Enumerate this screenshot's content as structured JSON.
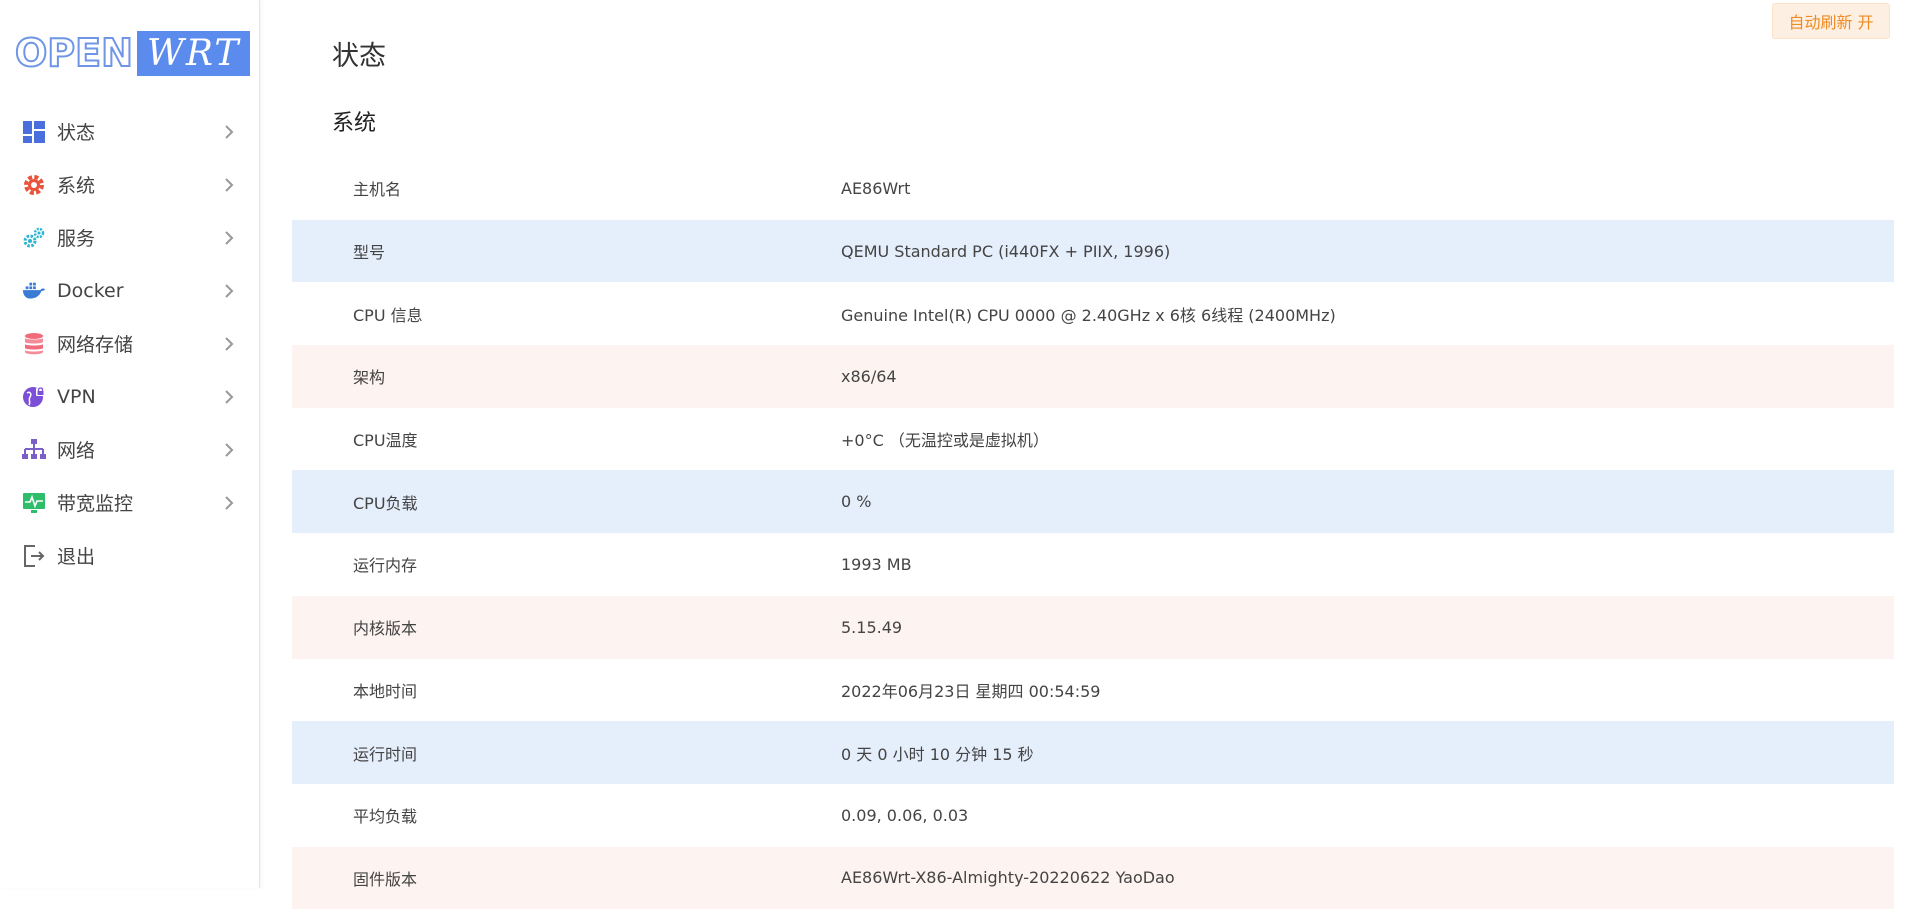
{
  "brand": {
    "logo_open": "OPEN",
    "logo_wrt": "WRT"
  },
  "sidebar": {
    "items": [
      {
        "label": "状态",
        "icon": "dashboard-icon",
        "has_chevron": true,
        "icon_color": "#4a6fdc"
      },
      {
        "label": "系统",
        "icon": "gear-icon",
        "has_chevron": true,
        "icon_color": "#e8533b"
      },
      {
        "label": "服务",
        "icon": "gears-icon",
        "has_chevron": true,
        "icon_color": "#2bb4d4"
      },
      {
        "label": "Docker",
        "icon": "docker-whale-icon",
        "has_chevron": true,
        "icon_color": "#3a7bd5"
      },
      {
        "label": "网络存储",
        "icon": "database-icon",
        "has_chevron": true,
        "icon_color": "#f06c7c"
      },
      {
        "label": "VPN",
        "icon": "globe-lock-icon",
        "has_chevron": true,
        "icon_color": "#7b4fd6"
      },
      {
        "label": "网络",
        "icon": "network-tree-icon",
        "has_chevron": true,
        "icon_color": "#7b5fc8"
      },
      {
        "label": "带宽监控",
        "icon": "monitor-pulse-icon",
        "has_chevron": true,
        "icon_color": "#2ebd6b"
      },
      {
        "label": "退出",
        "icon": "logout-icon",
        "has_chevron": false,
        "icon_color": "#666666"
      }
    ]
  },
  "header": {
    "page_title": "状态",
    "auto_refresh_label": "自动刷新 开"
  },
  "system": {
    "section_title": "系统",
    "rows": [
      {
        "key": "主机名",
        "value": "AE86Wrt"
      },
      {
        "key": "型号",
        "value": "QEMU Standard PC (i440FX + PIIX, 1996)"
      },
      {
        "key": "CPU 信息",
        "value": "Genuine Intel(R) CPU 0000 @ 2.40GHz x 6核 6线程 (2400MHz)"
      },
      {
        "key": "架构",
        "value": "x86/64"
      },
      {
        "key": "CPU温度",
        "value": "+0°C （无温控或是虚拟机）"
      },
      {
        "key": "CPU负载",
        "value": "0 %"
      },
      {
        "key": "运行内存",
        "value": "1993 MB"
      },
      {
        "key": "内核版本",
        "value": "5.15.49"
      },
      {
        "key": "本地时间",
        "value": "2022年06月23日 星期四 00:54:59"
      },
      {
        "key": "运行时间",
        "value": "0 天 0 小时 10 分钟 15 秒"
      },
      {
        "key": "平均负载",
        "value": "0.09, 0.06, 0.03"
      },
      {
        "key": "固件版本",
        "value": "AE86Wrt-X86-Almighty-20220622 YaoDao"
      }
    ]
  },
  "colors": {
    "accent": "#5b8bec",
    "row_blue": "#e5eefb",
    "row_pink": "#fdf4f1",
    "refresh_text": "#f08a24",
    "refresh_bg": "#fdf0e2"
  }
}
